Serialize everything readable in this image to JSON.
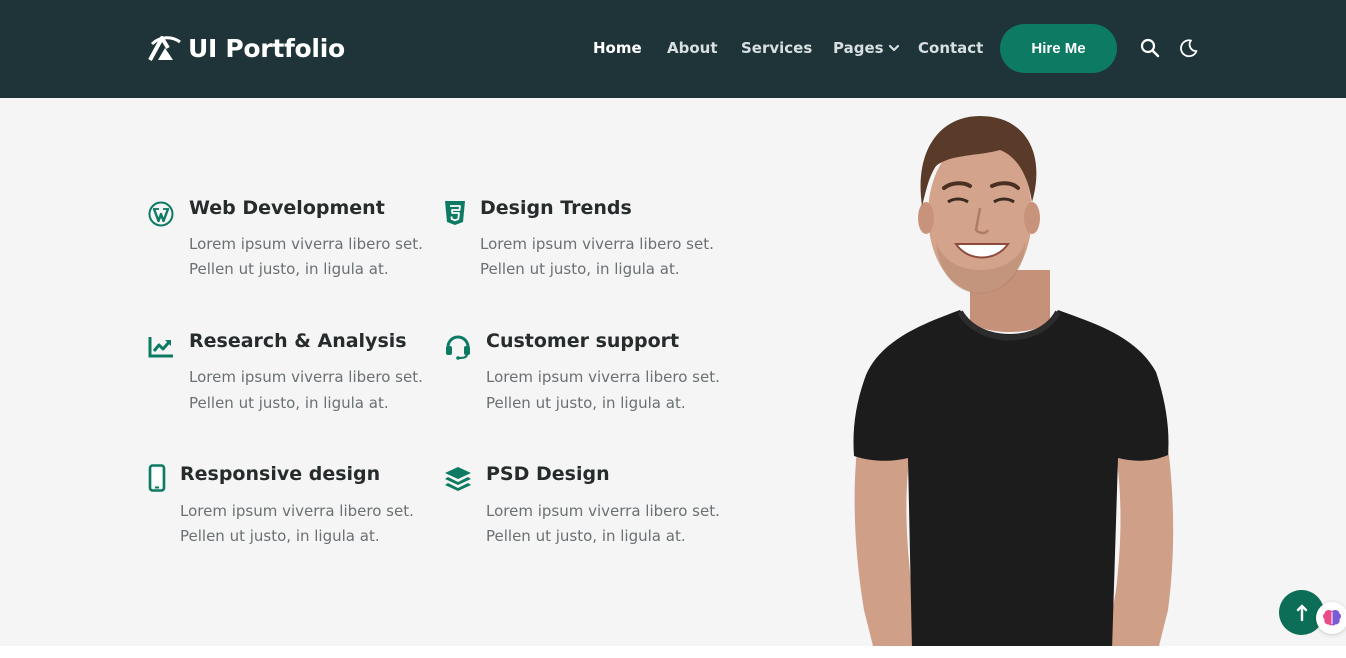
{
  "header": {
    "brand": "UI Portfolio",
    "nav": {
      "home": "Home",
      "about": "About",
      "services": "Services",
      "pages": "Pages",
      "contact": "Contact"
    },
    "hire_button": "Hire Me",
    "icons": [
      "logo-icon",
      "chevron-down-icon",
      "search-icon",
      "moon-icon"
    ]
  },
  "features": [
    {
      "title": "Web Development",
      "line1": "Lorem ipsum viverra libero set.",
      "line2": "Pellen ut justo, in ligula at.",
      "icon": "wordpress-icon"
    },
    {
      "title": "Design Trends",
      "line1": "Lorem ipsum viverra libero set.",
      "line2": "Pellen ut justo, in ligula at.",
      "icon": "css3-icon"
    },
    {
      "title": "Research & Analysis",
      "line1": "Lorem ipsum viverra libero set.",
      "line2": "Pellen ut justo, in ligula at.",
      "icon": "chart-line-icon"
    },
    {
      "title": "Customer support",
      "line1": "Lorem ipsum viverra libero set.",
      "line2": "Pellen ut justo, in ligula at.",
      "icon": "headset-icon"
    },
    {
      "title": "Responsive design",
      "line1": "Lorem ipsum viverra libero set.",
      "line2": "Pellen ut justo, in ligula at.",
      "icon": "mobile-icon"
    },
    {
      "title": "PSD Design",
      "line1": "Lorem ipsum viverra libero set.",
      "line2": "Pellen ut justo, in ligula at.",
      "icon": "layers-icon"
    }
  ],
  "floating": {
    "scroll_top_icon": "arrow-up-icon",
    "assistant_icon": "brain-icon"
  },
  "colors": {
    "header_bg": "#1e3438",
    "accent": "#0d7a63",
    "page_bg": "#f5f5f5",
    "title_text": "#262b2c",
    "body_text": "#6a7073"
  }
}
